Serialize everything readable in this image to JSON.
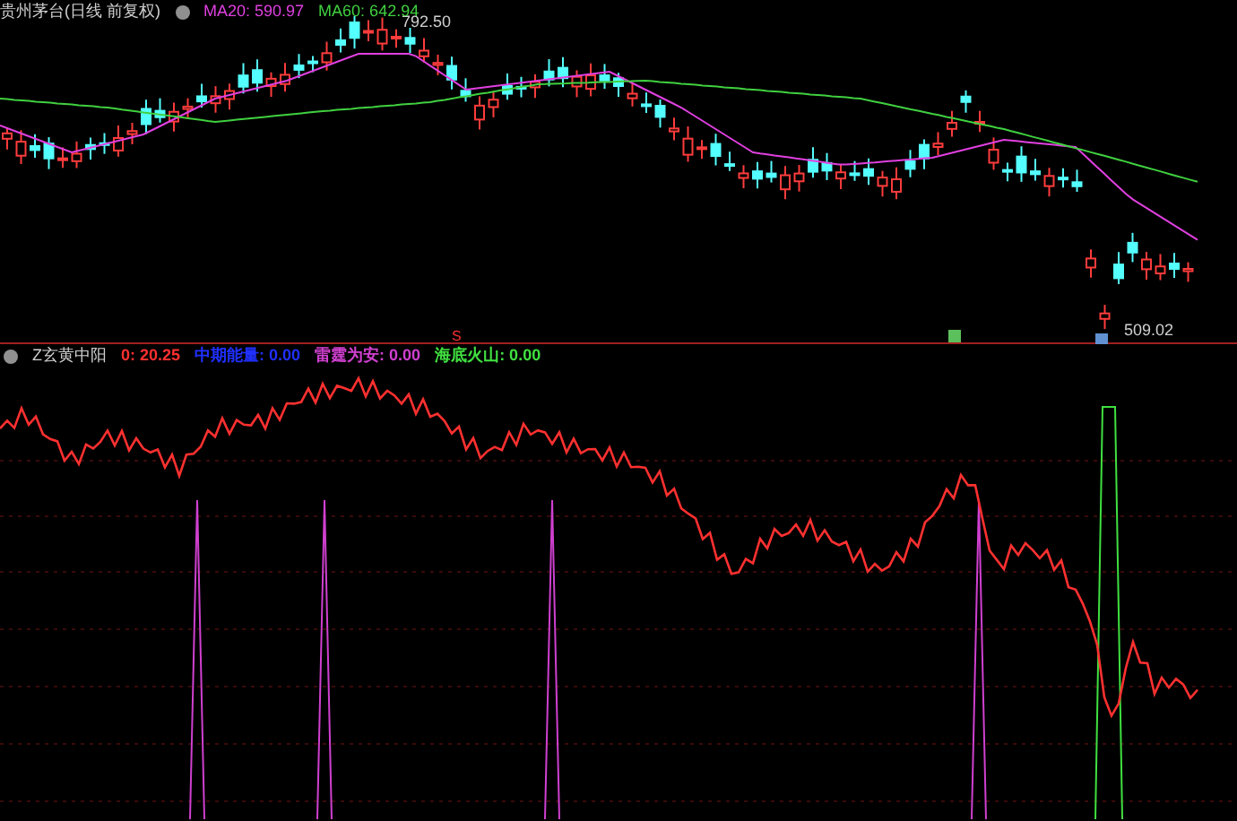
{
  "chart_title": "贵州茅台(日线 前复权)",
  "ma_legend": [
    {
      "label": "MA20: 590.97",
      "color": "#e040e0"
    },
    {
      "label": "MA60: 642.94",
      "color": "#40d040"
    }
  ],
  "price_labels": [
    {
      "text": "792.50"
    },
    {
      "text": "509.02"
    }
  ],
  "sell_marker": "S",
  "indicator": {
    "name": "Z玄黄中阳",
    "values": [
      {
        "label": "0: 20.25",
        "color": "#ff3030"
      },
      {
        "label": "中期能量: 0.00",
        "color": "#2030ff"
      },
      {
        "label": "雷霆为安: 0.00",
        "color": "#d040d0"
      },
      {
        "label": "海底火山: 0.00",
        "color": "#40e040"
      }
    ]
  }
}
